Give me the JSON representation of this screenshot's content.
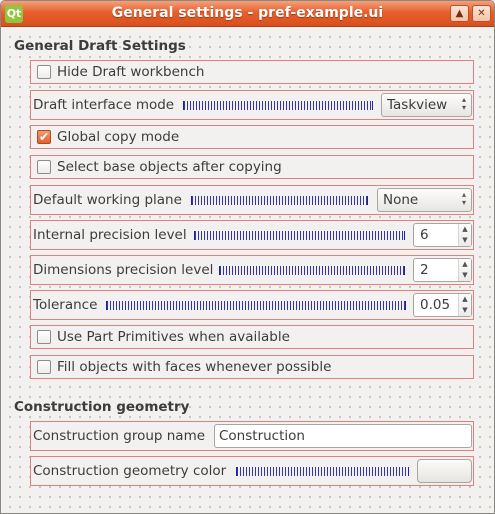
{
  "window": {
    "title": "General settings - pref-example.ui",
    "icon": "Qt",
    "minimize": "▲",
    "close": "✕"
  },
  "general": {
    "title": "General Draft Settings",
    "hide_draft_workbench": {
      "label": "Hide Draft workbench",
      "checked": false
    },
    "draft_interface_mode": {
      "label": "Draft interface mode",
      "value": "Taskview"
    },
    "global_copy_mode": {
      "label": "Global copy mode",
      "checked": true
    },
    "select_base_objects": {
      "label": "Select base objects after copying",
      "checked": false
    },
    "default_working_plane": {
      "label": "Default working plane",
      "value": "None"
    },
    "internal_precision": {
      "label": "Internal precision level",
      "value": "6"
    },
    "dimensions_precision": {
      "label": "Dimensions precision level",
      "value": "2"
    },
    "tolerance": {
      "label": "Tolerance",
      "value": "0.05"
    },
    "use_part_primitives": {
      "label": "Use Part Primitives when available",
      "checked": false
    },
    "fill_objects": {
      "label": "Fill objects with faces whenever possible",
      "checked": false
    }
  },
  "construction": {
    "title": "Construction geometry",
    "group_name": {
      "label": "Construction group name",
      "value": "Construction"
    },
    "geometry_color": {
      "label": "Construction geometry color"
    }
  },
  "icons": {
    "checkmark": "✔",
    "up": "▲",
    "down": "▼"
  },
  "colors": {
    "titlebar": "#e85f2c",
    "row_border": "#e28080",
    "spacer": "#3333b0"
  }
}
